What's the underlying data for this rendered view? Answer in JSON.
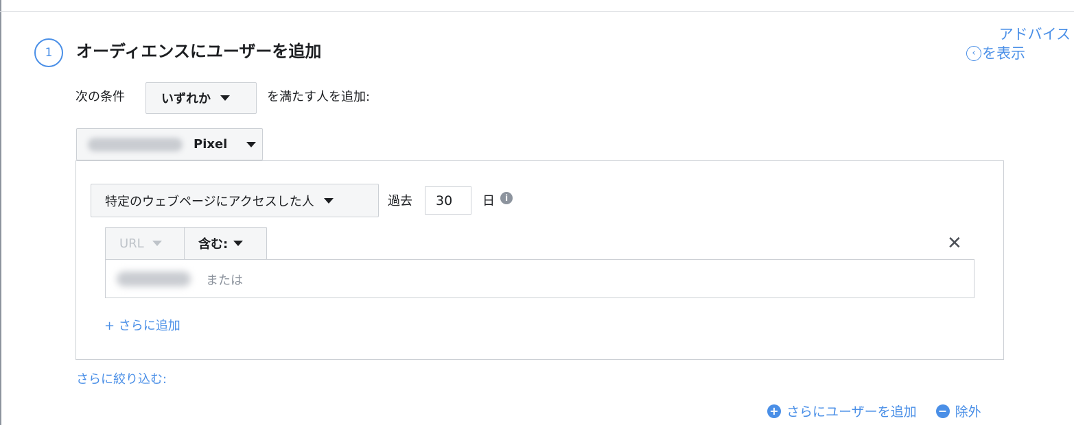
{
  "step": {
    "number": "1",
    "title": "オーディエンスにユーザーを追加"
  },
  "advice": {
    "line1": "アドバイス",
    "line2": "を表示",
    "icon": "chevron-left-circle-icon"
  },
  "condition": {
    "prefix": "次の条件",
    "selected": "いずれか",
    "suffix": "を満たす人を追加:"
  },
  "pixel": {
    "label": "Pixel"
  },
  "rule": {
    "event": "特定のウェブページにアクセスした人",
    "past_label": "過去",
    "days": "30",
    "day_unit": "日",
    "url_field": "URL",
    "operator": "含む:",
    "or_placeholder": "または",
    "add_more": "+ さらに追加"
  },
  "narrow_label": "さらに絞り込む:",
  "footer": {
    "add_users": "さらにユーザーを追加",
    "exclude": "除外"
  },
  "colors": {
    "accent": "#4a8fe7",
    "border": "#ccd0d5",
    "dropdown_bg": "#f5f6f7"
  }
}
